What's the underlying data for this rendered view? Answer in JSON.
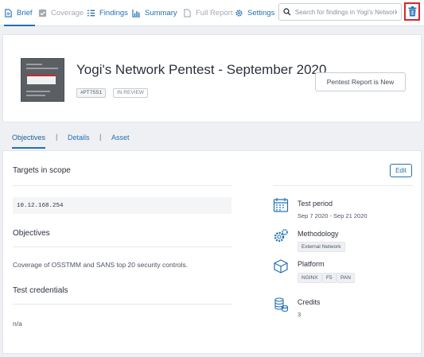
{
  "nav": {
    "brief": "Brief",
    "coverage": "Coverage",
    "findings": "Findings",
    "summary": "Summary",
    "full_report": "Full Report",
    "settings": "Settings",
    "search_placeholder": "Search for findings in Yogi's Network Pe"
  },
  "header": {
    "title": "Yogi's Network Pentest - September 2020",
    "tag_id": "#PT7551",
    "tag_status": "IN REVIEW",
    "report_button": "Pentest Report is New"
  },
  "tabs": {
    "objectives": "Objectives",
    "details": "Details",
    "asset": "Asset",
    "separator": "|"
  },
  "content": {
    "targets_title": "Targets in scope",
    "edit_label": "Edit",
    "target_ip": "10.12.168.254",
    "objectives_title": "Objectives",
    "objectives_text": "Coverage of OSSTMM and SANS top 20 security controls.",
    "credentials_title": "Test credentials",
    "credentials_text": "n/a"
  },
  "info": {
    "test_period_label": "Test period",
    "test_period_value": "Sep 7 2020 - Sep 21 2020",
    "methodology_label": "Methodology",
    "methodology_chip": "External Network",
    "platform_label": "Platform",
    "platform_chips": [
      "NGINX",
      "F5",
      "PAN"
    ],
    "credits_label": "Credits",
    "credits_value": "3"
  },
  "colors": {
    "accent": "#2470b3",
    "highlight_border": "#d8262a"
  }
}
